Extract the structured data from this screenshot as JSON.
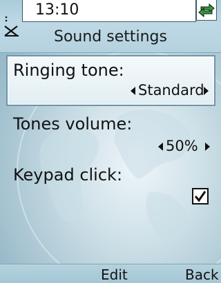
{
  "status": {
    "time": "13:10",
    "antenna_icon": "antenna-icon",
    "sync_icon": "sync-arrows-icon"
  },
  "header": {
    "title": "Sound settings"
  },
  "settings": {
    "ringing_tone": {
      "label": "Ringing tone:",
      "value": "Standard"
    },
    "tones_volume": {
      "label": "Tones volume:",
      "value": "50%"
    },
    "keypad_click": {
      "label": "Keypad click:",
      "checked": true
    }
  },
  "softkeys": {
    "center": "Edit",
    "right": "Back"
  },
  "colors": {
    "accent": "#6e94a8",
    "background": "#b3cdd8",
    "sync_green": "#2e9e3a"
  }
}
